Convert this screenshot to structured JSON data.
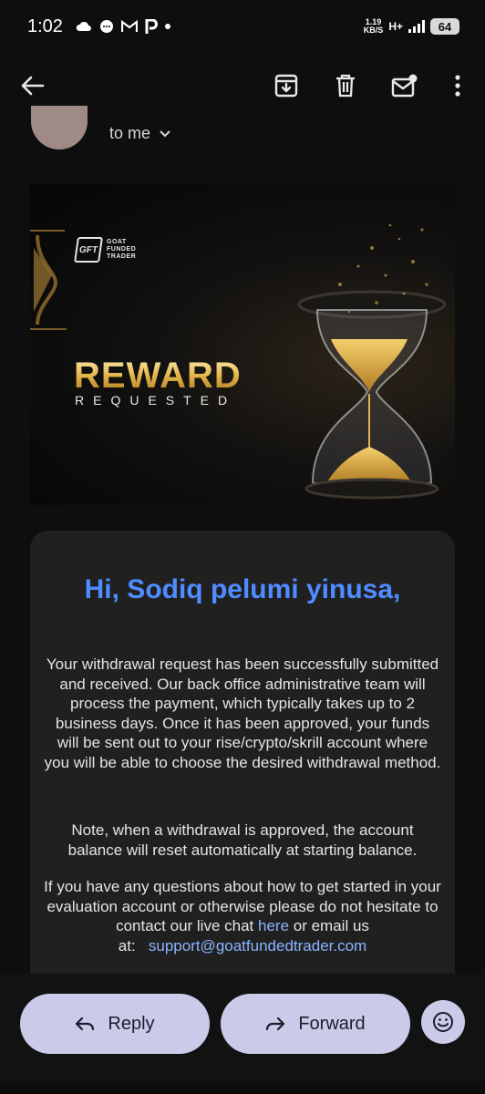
{
  "status_bar": {
    "time": "1:02",
    "notification_icons": [
      "cloud-icon",
      "chat-icon",
      "gmail-icon",
      "p-icon",
      "dot-icon"
    ],
    "speed_value": "1.19",
    "speed_unit": "KB/S",
    "network": "H+",
    "battery": "64"
  },
  "toolbar": {
    "icons": [
      "back-arrow-icon",
      "archive-icon",
      "delete-icon",
      "mark-unread-icon",
      "more-icon"
    ]
  },
  "email": {
    "recipient_line": "to me",
    "banner": {
      "logo_mark": "GFT",
      "logo_line1": "GOAT",
      "logo_line2": "FUNDED",
      "logo_line3": "TRADER",
      "headline": "REWARD",
      "subheadline": "REQUESTED"
    },
    "greeting": "Hi, Sodiq pelumi yinusa,",
    "paragraph1": "Your withdrawal request has been successfully submitted and received. Our back office administrative team will process the payment, which typically takes up to 2 business days. Once it has been approved, your funds will be sent out to your rise/crypto/skrill account where you will be able to choose the desired withdrawal method.",
    "paragraph2": "Note, when a withdrawal is approved, the account balance will reset automatically at starting balance.",
    "paragraph3_part1": "If you have any questions about how to get started in your evaluation account or otherwise please do not hesitate to contact our live chat ",
    "paragraph3_link": "here",
    "paragraph3_part2": " or email us at:",
    "support_email": "support@goatfundedtrader.com"
  },
  "actions": {
    "reply_label": "Reply",
    "forward_label": "Forward"
  },
  "colors": {
    "greeting": "#4f8cff",
    "button_bg": "#c9cbe9",
    "link": "#8ab4ff"
  }
}
